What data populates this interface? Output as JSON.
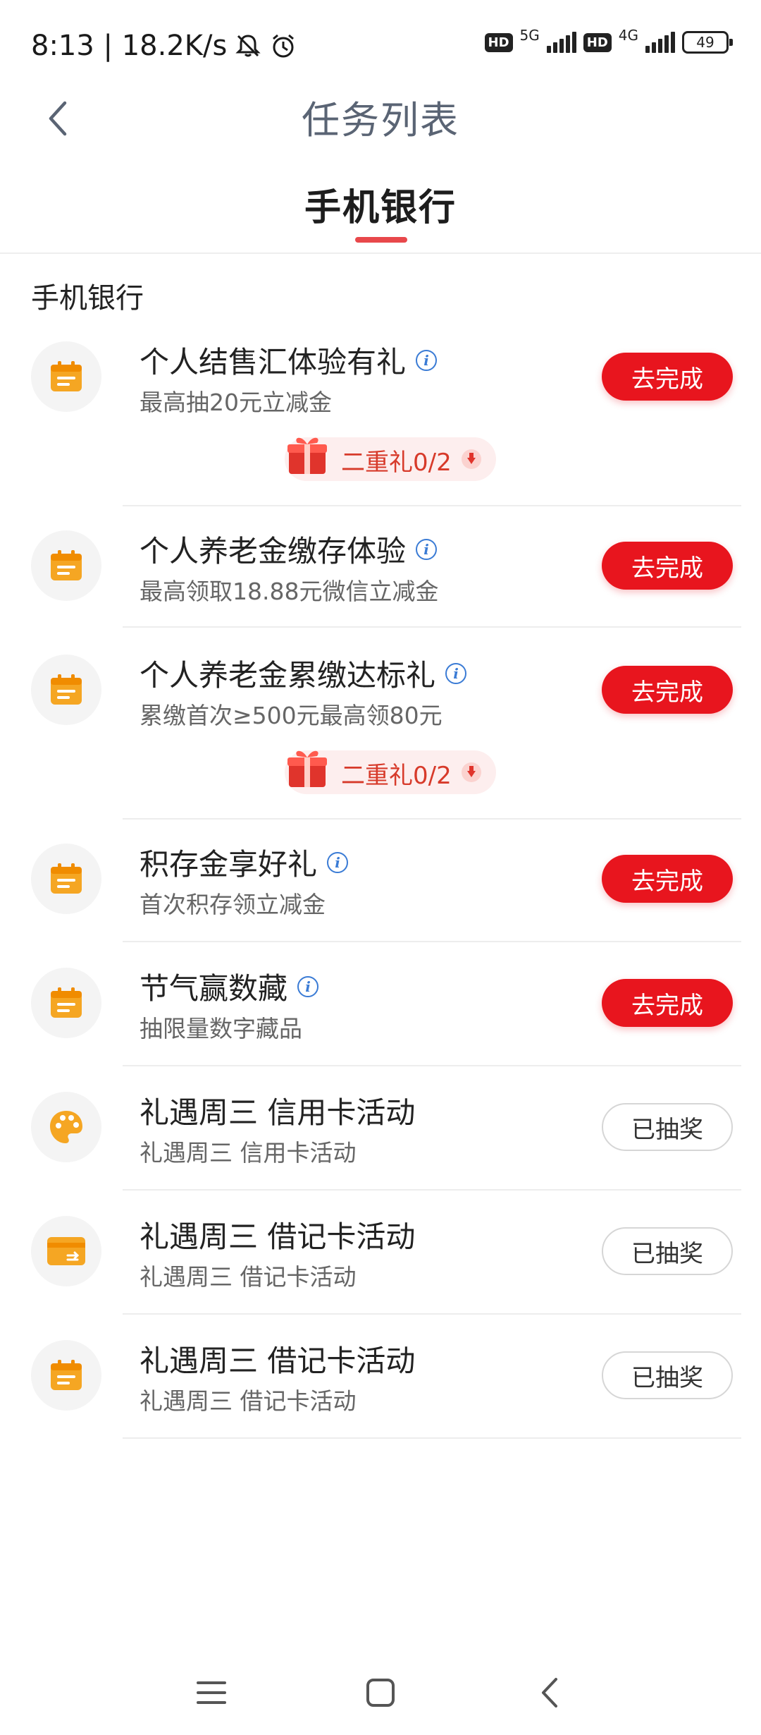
{
  "status_bar": {
    "time_speed": "8:13 | 18.2K/s",
    "sim1_network": "5G",
    "sim2_network": "4G",
    "hd_label": "HD",
    "battery": "49"
  },
  "header": {
    "title": "任务列表"
  },
  "tabs": [
    {
      "label": "手机银行",
      "active": true
    }
  ],
  "section": {
    "title": "手机银行"
  },
  "tasks": [
    {
      "title": "个人结售汇体验有礼",
      "subtitle": "最高抽20元立减金",
      "button": "去完成",
      "state": "todo",
      "icon": "calendar-icon",
      "bonus": "二重礼0/2"
    },
    {
      "title": "个人养老金缴存体验",
      "subtitle": "最高领取18.88元微信立减金",
      "button": "去完成",
      "state": "todo",
      "icon": "calendar-icon"
    },
    {
      "title": "个人养老金累缴达标礼",
      "subtitle": "累缴首次≥500元最高领80元",
      "button": "去完成",
      "state": "todo",
      "icon": "calendar-icon",
      "bonus": "二重礼0/2"
    },
    {
      "title": "积存金享好礼",
      "subtitle": "首次积存领立减金",
      "button": "去完成",
      "state": "todo",
      "icon": "calendar-icon"
    },
    {
      "title": "节气赢数藏",
      "subtitle": "抽限量数字藏品",
      "button": "去完成",
      "state": "todo",
      "icon": "calendar-icon"
    },
    {
      "title": "礼遇周三 信用卡活动",
      "subtitle": "礼遇周三 信用卡活动",
      "button": "已抽奖",
      "state": "done",
      "icon": "palette-icon"
    },
    {
      "title": "礼遇周三 借记卡活动",
      "subtitle": "礼遇周三 借记卡活动",
      "button": "已抽奖",
      "state": "done",
      "icon": "card-icon"
    },
    {
      "title": "礼遇周三 借记卡活动",
      "subtitle": "礼遇周三 借记卡活动",
      "button": "已抽奖",
      "state": "done",
      "icon": "calendar-icon"
    }
  ],
  "colors": {
    "accent_red": "#e8151e",
    "icon_orange": "#f5a623",
    "title_grey": "#5a6474"
  }
}
